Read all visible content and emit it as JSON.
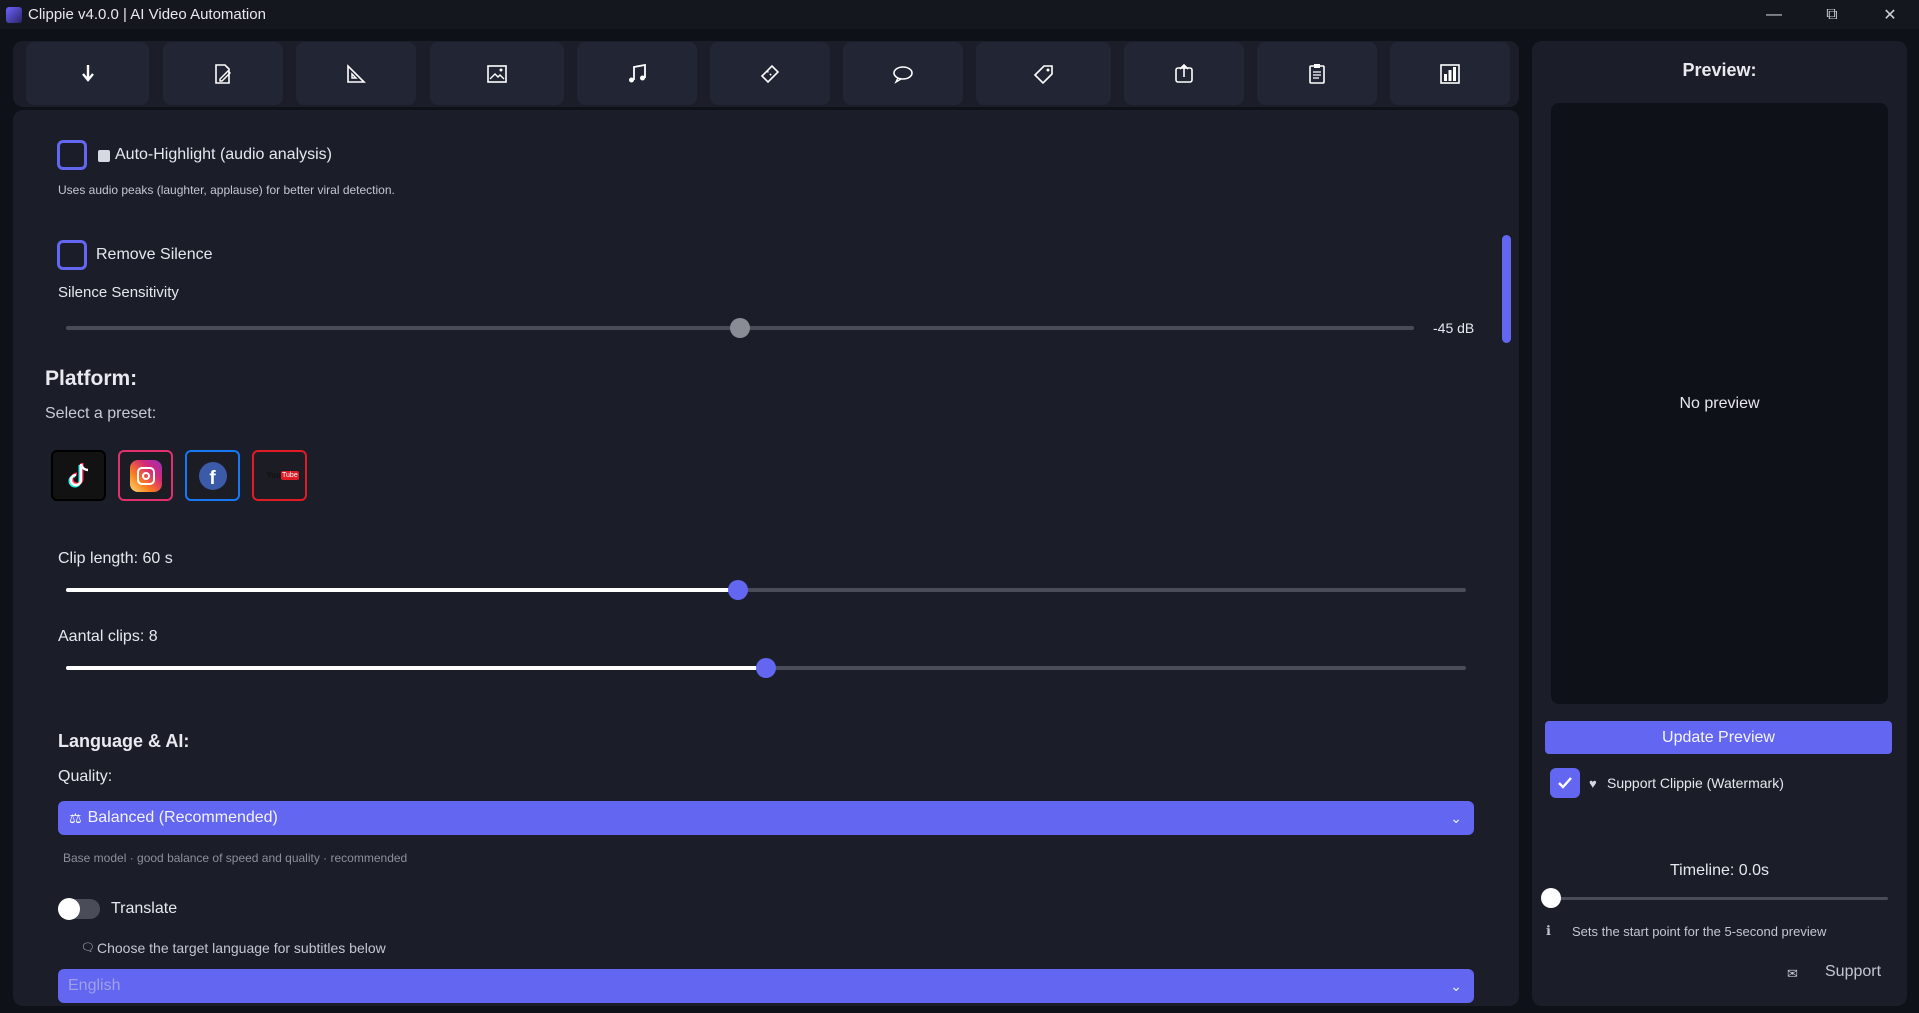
{
  "window": {
    "title": "Clippie v4.0.0 | AI Video Automation",
    "controls": [
      "minimize",
      "restore",
      "close"
    ]
  },
  "toolbar": {
    "buttons": [
      {
        "icon": "download-arrow-icon"
      },
      {
        "icon": "edit-document-icon"
      },
      {
        "icon": "set-square-icon"
      },
      {
        "icon": "image-frame-icon"
      },
      {
        "icon": "music-note-icon"
      },
      {
        "icon": "ticket-icon"
      },
      {
        "icon": "speech-bubble-icon"
      },
      {
        "icon": "tag-icon"
      },
      {
        "icon": "export-icon"
      },
      {
        "icon": "clipboard-icon"
      },
      {
        "icon": "bar-chart-icon"
      }
    ]
  },
  "main": {
    "auto_highlight": {
      "checked": false,
      "icon": "film-icon",
      "label": "Auto-Highlight (audio analysis)",
      "hint": "Uses audio peaks (laughter, applause) for better viral detection."
    },
    "remove_silence": {
      "checked": false,
      "label": "Remove Silence"
    },
    "silence_sensitivity": {
      "label": "Silence Sensitivity",
      "value_text": "-45 dB",
      "position_fraction": 0.5
    },
    "platform": {
      "heading": "Platform:",
      "sublabel": "Select a preset:",
      "presets": [
        {
          "name": "TikTok",
          "icon": "tiktok-icon",
          "border": "#0b0b0b"
        },
        {
          "name": "Instagram",
          "icon": "instagram-icon",
          "border": "#e1306c"
        },
        {
          "name": "Facebook",
          "icon": "facebook-icon",
          "border": "#1877f2"
        },
        {
          "name": "YouTube",
          "icon": "youtube-icon",
          "border": "#e01b24"
        }
      ]
    },
    "clip_length": {
      "label": "Clip length: 60 s",
      "fraction": 0.48
    },
    "clip_count": {
      "label": "Aantal clips: 8",
      "fraction": 0.5
    },
    "language_ai": {
      "heading": "Language & AI:",
      "quality_label": "Quality:",
      "quality_value": "Balanced (Recommended)",
      "quality_icon": "scale-icon",
      "quality_hint": "Base model · good balance of speed and quality · recommended",
      "translate_label": "Translate",
      "translate_on": false,
      "translate_hint_icon": "speech-icon",
      "translate_hint": "Choose the target language for subtitles below",
      "language_value": "English"
    }
  },
  "preview": {
    "title": "Preview:",
    "empty_text": "No preview",
    "update_button": "Update Preview",
    "watermark": {
      "checked": true,
      "icon": "heart-icon",
      "label": "Support Clippie (Watermark)"
    },
    "timeline_label": "Timeline: 0.0s",
    "timeline_fraction": 0,
    "timeline_hint": "Sets the start point for the 5-second preview",
    "info_icon": "info-icon",
    "support_icon": "mail-icon",
    "support_label": "Support"
  },
  "colors": {
    "accent": "#6366f1",
    "background": "#0f1118",
    "panel": "#1b1e28"
  }
}
